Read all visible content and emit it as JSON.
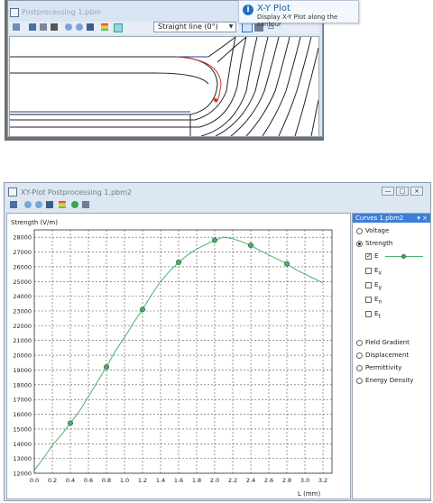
{
  "top_window": {
    "title": "Postprocessing 1.pbm",
    "contour_type": "Straight line (0°)",
    "tooltip": {
      "title": "X-Y Plot",
      "description": "Display X-Y Plot along the contour"
    }
  },
  "xy_window": {
    "title": "XY-Plot Postprocessing 1.pbm2",
    "controls": {
      "minimize": "—",
      "maximize": "□",
      "close": "×"
    }
  },
  "side_panel": {
    "title": "Curves 1.pbm2",
    "header_controls": "▾ ×",
    "options": [
      {
        "label": "Voltage",
        "selected": false
      },
      {
        "label": "Strength",
        "selected": true
      },
      {
        "label": "Field Gradient",
        "selected": false
      },
      {
        "label": "Displacement",
        "selected": false
      },
      {
        "label": "Permittivity",
        "selected": false
      },
      {
        "label": "Energy Density",
        "selected": false
      }
    ],
    "components": [
      {
        "main": "E",
        "sub": "",
        "checked": true
      },
      {
        "main": "E",
        "sub": "x",
        "checked": false
      },
      {
        "main": "E",
        "sub": "y",
        "checked": false
      },
      {
        "main": "E",
        "sub": "n",
        "checked": false
      },
      {
        "main": "E",
        "sub": "t",
        "checked": false
      }
    ]
  },
  "chart_data": {
    "type": "line",
    "ylabel": "Strength (V/m)",
    "xlabel": "L (mm)",
    "xlim": [
      0,
      3.3
    ],
    "ylim": [
      12000,
      28500
    ],
    "grid": true,
    "x_ticks": [
      "0.0",
      "0.2",
      "0.4",
      "0.6",
      "0.8",
      "1.0",
      "1.2",
      "1.4",
      "1.6",
      "1.8",
      "2.0",
      "2.2",
      "2.4",
      "2.6",
      "2.8",
      "3.0",
      "3.2"
    ],
    "y_ticks": [
      "12000",
      "13000",
      "14000",
      "15000",
      "16000",
      "17000",
      "18000",
      "19000",
      "20000",
      "21000",
      "22000",
      "23000",
      "24000",
      "25000",
      "26000",
      "27000",
      "28000"
    ],
    "series": [
      {
        "color": "#4caf6e",
        "x": [
          0.0,
          0.1,
          0.2,
          0.3,
          0.4,
          0.5,
          0.6,
          0.7,
          0.8,
          0.9,
          1.0,
          1.1,
          1.2,
          1.3,
          1.4,
          1.5,
          1.6,
          1.7,
          1.8,
          1.9,
          2.0,
          2.1,
          2.2,
          2.3,
          2.4,
          2.5,
          2.6,
          2.7,
          2.8,
          2.9,
          3.0,
          3.1,
          3.2
        ],
        "y": [
          12200,
          13000,
          13900,
          14600,
          15400,
          16200,
          17200,
          18200,
          19200,
          20300,
          21200,
          22200,
          23100,
          24100,
          25000,
          25700,
          26300,
          26800,
          27200,
          27500,
          27800,
          28000,
          27900,
          27700,
          27450,
          27100,
          26800,
          26500,
          26200,
          25800,
          25500,
          25200,
          24900
        ]
      }
    ],
    "markers": [
      {
        "x": 0.4,
        "y": 15400
      },
      {
        "x": 0.8,
        "y": 19200
      },
      {
        "x": 1.2,
        "y": 23100
      },
      {
        "x": 1.6,
        "y": 26300
      },
      {
        "x": 2.0,
        "y": 27800
      },
      {
        "x": 2.4,
        "y": 27450
      },
      {
        "x": 2.8,
        "y": 26200
      }
    ]
  }
}
